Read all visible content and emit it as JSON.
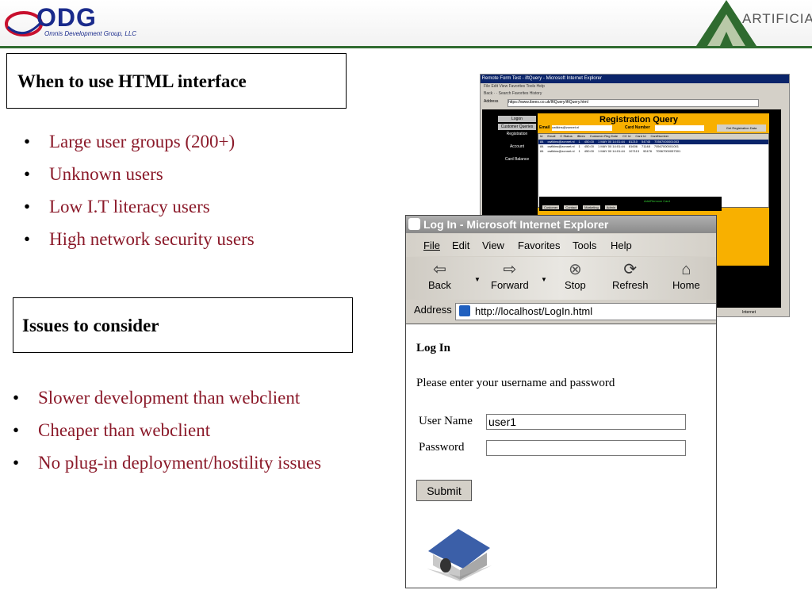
{
  "header": {
    "odg_logo_text": "ODG",
    "odg_tagline": "Omnis Development Group, LLC",
    "artificia_text": "ARTIFICIA"
  },
  "section1": {
    "title": "When to use HTML interface",
    "bullets": [
      "Large user groups (200+)",
      "Unknown users",
      "Low I.T literacy users",
      "High network security users"
    ]
  },
  "section2": {
    "title": "Issues to consider",
    "bullets": [
      "Slower development than webclient",
      "Cheaper than webclient",
      "No plug-in deployment/hostility issues"
    ]
  },
  "shot_small": {
    "title": "Remote Form Test - iftQuery - Microsoft Internet Explorer",
    "menu": "File  Edit  View  Favorites  Tools  Help",
    "tools": "Back ·  ·  Search  Favorites  History",
    "address_label": "Address",
    "address": "https://www.ibees.co.uk/IftQuery/iftQuery.html",
    "sidebar": [
      "Logon",
      "Customer Queries",
      "Registration",
      "Account",
      "Card Balance"
    ],
    "heading": "Registration Query",
    "email_label": "Email",
    "email_value": "cwilkins@zonnet.nl",
    "card_label": "Card Number",
    "get_button": "Get Registration Data",
    "columns": [
      "Id",
      "Email",
      "C Status",
      "iBees",
      "Customer Reg Date",
      "CC Id",
      "Card Id",
      "CardNumber"
    ],
    "rows": [
      [
        "84",
        "cwilkins@zonnet.nl",
        "1",
        "450.00",
        "1 MAY 00 14:01:44",
        "81210",
        "54745",
        "70567000001003"
      ],
      [
        "84",
        "cwilkins@zonnet.nl",
        "1",
        "450.00",
        "1 MAY 00 14:01:44",
        "81606",
        "71148",
        "70567000001001"
      ],
      [
        "84",
        "cwilkins@zonnet.nl",
        "1",
        "450.00",
        "1 MAY 00 14:01:44",
        "107113",
        "92476",
        "70567000057301"
      ]
    ],
    "tabs": [
      "Customer",
      "Contact",
      "Marketing",
      "Admin"
    ],
    "add_remove": "Add/Remove Card",
    "status": "Internet"
  },
  "browser": {
    "title": "Log In - Microsoft Internet Explorer",
    "menu": [
      "File",
      "Edit",
      "View",
      "Favorites",
      "Tools",
      "Help"
    ],
    "toolbar": {
      "back": "Back",
      "forward": "Forward",
      "stop": "Stop",
      "refresh": "Refresh",
      "home": "Home"
    },
    "address_label": "Address",
    "address": "http://localhost/LogIn.html",
    "page": {
      "heading": "Log In",
      "prompt": "Please enter your username and password",
      "username_label": "User Name",
      "username_value": "user1",
      "password_label": "Password",
      "password_value": "",
      "submit": "Submit"
    }
  },
  "colors": {
    "bullet_text": "#8b1a2a",
    "header_line": "#2f6b2f",
    "panel_orange": "#f8b000"
  }
}
